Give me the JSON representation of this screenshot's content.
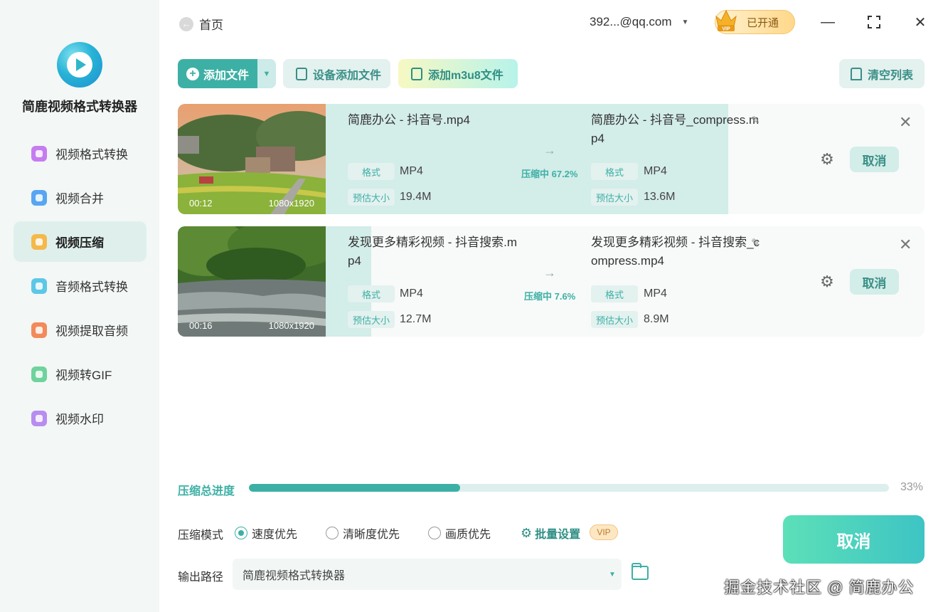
{
  "app": {
    "name": "简鹿视频格式转换器"
  },
  "sidebar": {
    "items": [
      {
        "label": "视频格式转换",
        "color": "#c57cf0"
      },
      {
        "label": "视频合并",
        "color": "#58a6f2"
      },
      {
        "label": "视频压缩",
        "color": "#f5b84a",
        "active": true
      },
      {
        "label": "音频格式转换",
        "color": "#5dc7e6"
      },
      {
        "label": "视频提取音频",
        "color": "#f28a5b"
      },
      {
        "label": "视频转GIF",
        "color": "#6ed39c"
      },
      {
        "label": "视频水印",
        "color": "#b88df0"
      }
    ]
  },
  "header": {
    "back_label": "首页",
    "account": "392...@qq.com",
    "vip_status": "已开通",
    "vip_badge": "VIP"
  },
  "toolbar": {
    "add_file": "添加文件",
    "device_add": "设备添加文件",
    "add_m3u8": "添加m3u8文件",
    "clear_list": "清空列表"
  },
  "files": [
    {
      "duration": "00:12",
      "resolution": "1080x1920",
      "src_name": "简鹿办公 - 抖音号.mp4",
      "dst_name": "简鹿办公 - 抖音号_compress.mp4",
      "format_label": "格式",
      "src_format": "MP4",
      "dst_format": "MP4",
      "size_label": "预估大小",
      "src_size": "19.4M",
      "dst_size": "13.6M",
      "status": "压缩中 67.2%",
      "progress": 0.672,
      "cancel": "取消"
    },
    {
      "duration": "00:16",
      "resolution": "1080x1920",
      "src_name": "发现更多精彩视频 - 抖音搜索.mp4",
      "dst_name": "发现更多精彩视频 - 抖音搜索_compress.mp4",
      "format_label": "格式",
      "src_format": "MP4",
      "dst_format": "MP4",
      "size_label": "预估大小",
      "src_size": "12.7M",
      "dst_size": "8.9M",
      "status": "压缩中 7.6%",
      "progress": 0.076,
      "cancel": "取消"
    }
  ],
  "total": {
    "label": "压缩总进度",
    "percent_text": "33%",
    "progress": 0.33
  },
  "mode": {
    "label": "压缩模式",
    "options": [
      "速度优先",
      "清晰度优先",
      "画质优先"
    ],
    "selected": 0,
    "batch": "批量设置",
    "vip": "VIP"
  },
  "output": {
    "label": "输出路径",
    "value": "简鹿视频格式转换器"
  },
  "big_cancel": "取消",
  "watermark": "掘金技术社区 @ 简鹿办公",
  "colors": {
    "accent": "#3db0a5",
    "progress_bg": "#d3ede9"
  }
}
